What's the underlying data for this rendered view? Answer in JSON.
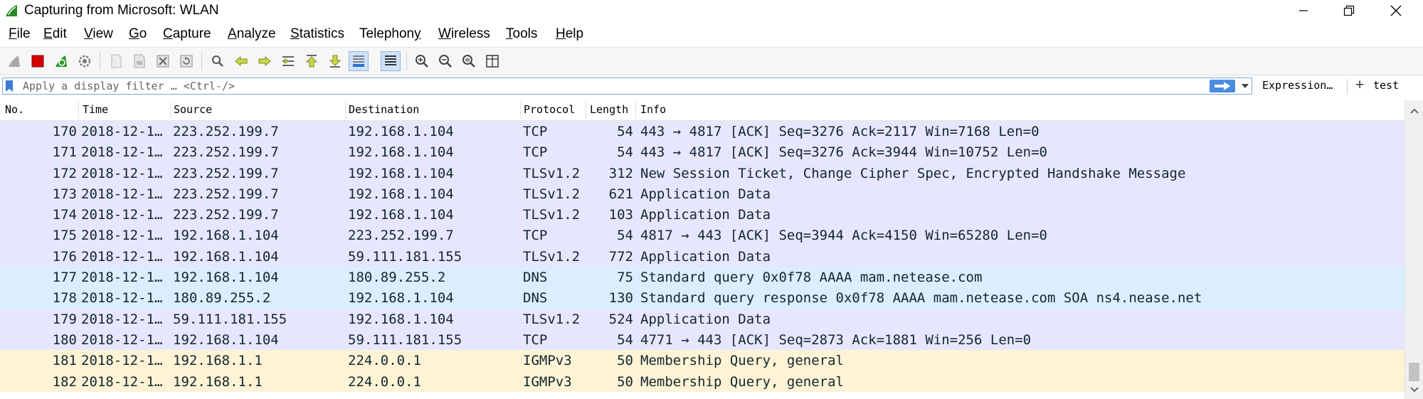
{
  "window": {
    "title": "Capturing from Microsoft: WLAN",
    "app_icon": "wireshark-fin-icon"
  },
  "menu": [
    {
      "pre": "",
      "ul": "F",
      "post": "ile"
    },
    {
      "pre": "",
      "ul": "E",
      "post": "dit"
    },
    {
      "pre": "",
      "ul": "V",
      "post": "iew"
    },
    {
      "pre": "",
      "ul": "G",
      "post": "o"
    },
    {
      "pre": "",
      "ul": "C",
      "post": "apture"
    },
    {
      "pre": "",
      "ul": "A",
      "post": "nalyze"
    },
    {
      "pre": "",
      "ul": "S",
      "post": "tatistics"
    },
    {
      "pre": "Telephon",
      "ul": "y",
      "post": ""
    },
    {
      "pre": "",
      "ul": "W",
      "post": "ireless"
    },
    {
      "pre": "",
      "ul": "T",
      "post": "ools"
    },
    {
      "pre": "",
      "ul": "H",
      "post": "elp"
    }
  ],
  "filter": {
    "placeholder": "Apply a display filter … <Ctrl-/>",
    "expression_label": "Expression…",
    "plus_label": "+",
    "test_label": "test"
  },
  "columns": {
    "no": "No.",
    "time": "Time",
    "source": "Source",
    "destination": "Destination",
    "protocol": "Protocol",
    "length": "Length",
    "info": "Info"
  },
  "packets": [
    {
      "no": "170",
      "time": "2018-12-1…",
      "src": "223.252.199.7",
      "dst": "192.168.1.104",
      "proto": "TCP",
      "len": "54",
      "info": "443 → 4817 [ACK] Seq=3276 Ack=2117 Win=7168 Len=0",
      "color": "tcp"
    },
    {
      "no": "171",
      "time": "2018-12-1…",
      "src": "223.252.199.7",
      "dst": "192.168.1.104",
      "proto": "TCP",
      "len": "54",
      "info": "443 → 4817 [ACK] Seq=3276 Ack=3944 Win=10752 Len=0",
      "color": "tcp"
    },
    {
      "no": "172",
      "time": "2018-12-1…",
      "src": "223.252.199.7",
      "dst": "192.168.1.104",
      "proto": "TLSv1.2",
      "len": "312",
      "info": "New Session Ticket, Change Cipher Spec, Encrypted Handshake Message",
      "color": "tcp"
    },
    {
      "no": "173",
      "time": "2018-12-1…",
      "src": "223.252.199.7",
      "dst": "192.168.1.104",
      "proto": "TLSv1.2",
      "len": "621",
      "info": "Application Data",
      "color": "tcp"
    },
    {
      "no": "174",
      "time": "2018-12-1…",
      "src": "223.252.199.7",
      "dst": "192.168.1.104",
      "proto": "TLSv1.2",
      "len": "103",
      "info": "Application Data",
      "color": "tcp"
    },
    {
      "no": "175",
      "time": "2018-12-1…",
      "src": "192.168.1.104",
      "dst": "223.252.199.7",
      "proto": "TCP",
      "len": "54",
      "info": "4817 → 443 [ACK] Seq=3944 Ack=4150 Win=65280 Len=0",
      "color": "tcp"
    },
    {
      "no": "176",
      "time": "2018-12-1…",
      "src": "192.168.1.104",
      "dst": "59.111.181.155",
      "proto": "TLSv1.2",
      "len": "772",
      "info": "Application Data",
      "color": "tcp"
    },
    {
      "no": "177",
      "time": "2018-12-1…",
      "src": "192.168.1.104",
      "dst": "180.89.255.2",
      "proto": "DNS",
      "len": "75",
      "info": "Standard query 0x0f78 AAAA mam.netease.com",
      "color": "udp"
    },
    {
      "no": "178",
      "time": "2018-12-1…",
      "src": "180.89.255.2",
      "dst": "192.168.1.104",
      "proto": "DNS",
      "len": "130",
      "info": "Standard query response 0x0f78 AAAA mam.netease.com SOA ns4.nease.net",
      "color": "udp"
    },
    {
      "no": "179",
      "time": "2018-12-1…",
      "src": "59.111.181.155",
      "dst": "192.168.1.104",
      "proto": "TLSv1.2",
      "len": "524",
      "info": "Application Data",
      "color": "tcp"
    },
    {
      "no": "180",
      "time": "2018-12-1…",
      "src": "192.168.1.104",
      "dst": "59.111.181.155",
      "proto": "TCP",
      "len": "54",
      "info": "4771 → 443 [ACK] Seq=2873 Ack=1881 Win=256 Len=0",
      "color": "tcp"
    },
    {
      "no": "181",
      "time": "2018-12-1…",
      "src": "192.168.1.1",
      "dst": "224.0.0.1",
      "proto": "IGMPv3",
      "len": "50",
      "info": "Membership Query, general",
      "color": "igmp"
    },
    {
      "no": "182",
      "time": "2018-12-1…",
      "src": "192.168.1.1",
      "dst": "224.0.0.1",
      "proto": "IGMPv3",
      "len": "50",
      "info": "Membership Query, general",
      "color": "igmp"
    }
  ],
  "row_colors": {
    "tcp": "#e7e6ff",
    "udp": "#daeeff",
    "igmp": "#fff3d6"
  }
}
